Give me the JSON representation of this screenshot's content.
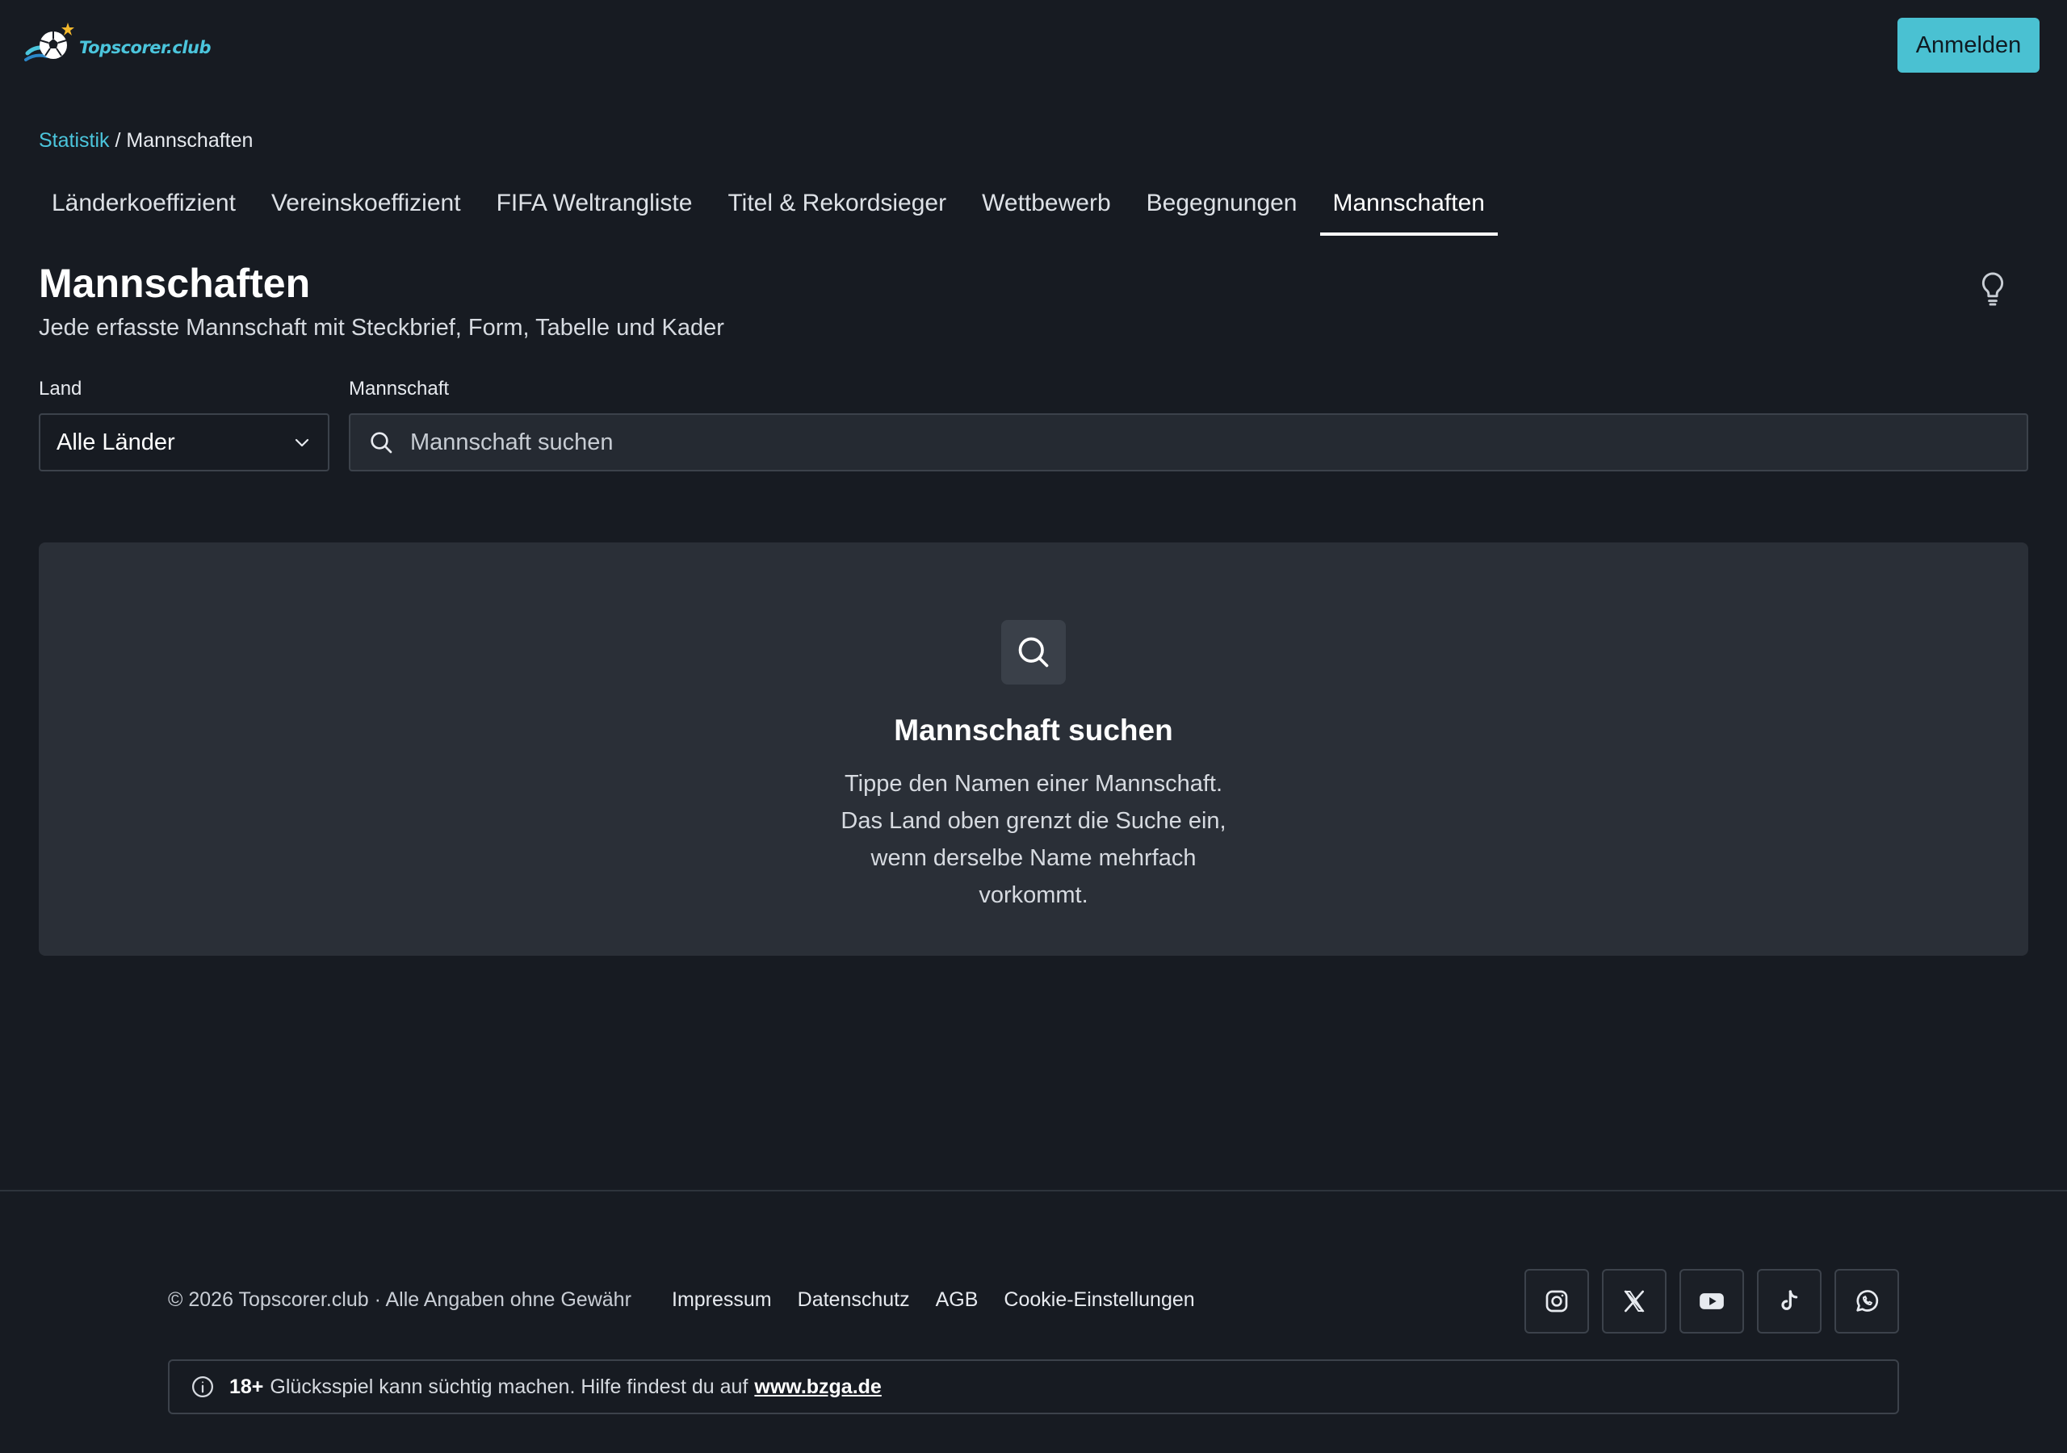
{
  "header": {
    "logo_text": "Topscorer.club",
    "login_label": "Anmelden"
  },
  "breadcrumb": {
    "root": "Statistik",
    "separator": " / ",
    "current": "Mannschaften"
  },
  "tabs": [
    {
      "label": "Länderkoeffizient"
    },
    {
      "label": "Vereinskoeffizient"
    },
    {
      "label": "FIFA Weltrangliste"
    },
    {
      "label": "Titel & Rekordsieger"
    },
    {
      "label": "Wettbewerb"
    },
    {
      "label": "Begegnungen"
    },
    {
      "label": "Mannschaften",
      "active": true
    }
  ],
  "page": {
    "title": "Mannschaften",
    "subtitle": "Jede erfasste Mannschaft mit Steckbrief, Form, Tabelle und Kader"
  },
  "filters": {
    "country_label": "Land",
    "country_value": "Alle Länder",
    "team_label": "Mannschaft",
    "team_placeholder": "Mannschaft suchen"
  },
  "empty_state": {
    "title": "Mannschaft suchen",
    "text": "Tippe den Namen einer Mannschaft. Das Land oben grenzt die Suche ein, wenn derselbe Name mehrfach vorkommt."
  },
  "footer": {
    "copyright": "© 2026 Topscorer.club · Alle Angaben ohne Gewähr",
    "links": [
      "Impressum",
      "Datenschutz",
      "AGB",
      "Cookie-Einstellungen"
    ],
    "social": [
      "instagram-icon",
      "x-icon",
      "youtube-icon",
      "tiktok-icon",
      "whatsapp-icon"
    ],
    "warning_age": "18+",
    "warning_text": "Glücksspiel kann süchtig machen. Hilfe findest du auf",
    "warning_link": "www.bzga.de"
  },
  "colors": {
    "background": "#171b22",
    "accent": "#4ac1d2",
    "panel": "#2a2f37"
  }
}
